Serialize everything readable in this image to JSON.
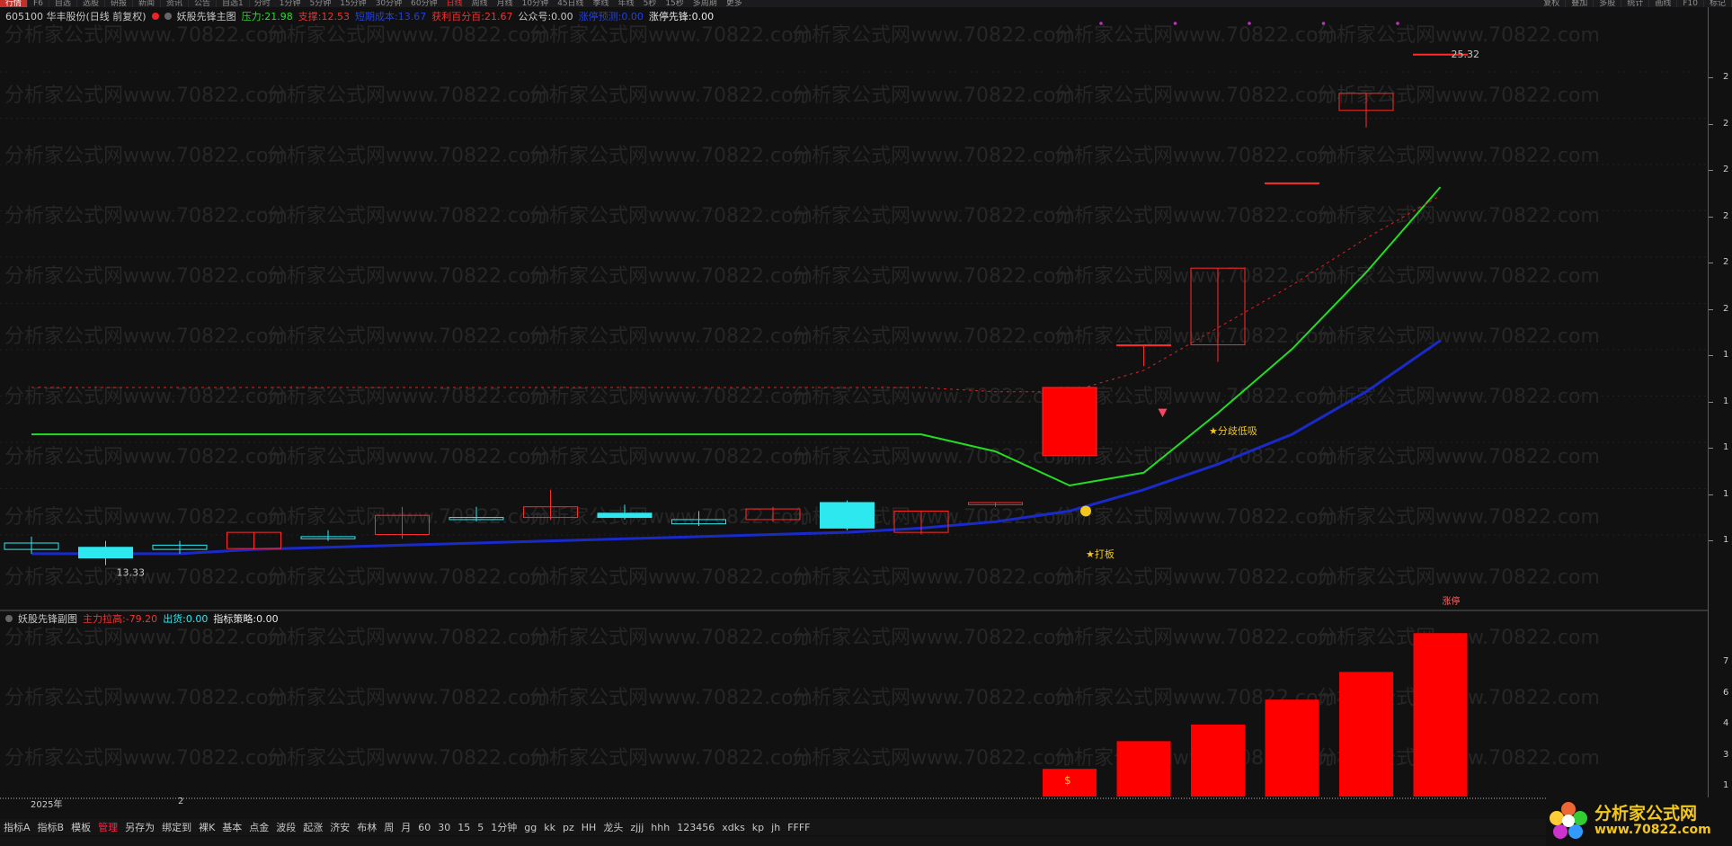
{
  "toolbar": {
    "items": [
      "行情",
      "F6",
      "自选",
      "选股",
      "研报",
      "新闻",
      "资讯",
      "公告",
      "自选1"
    ],
    "timeframes": [
      "分时",
      "1分钟",
      "5分钟",
      "15分钟",
      "30分钟",
      "60分钟",
      "日线",
      "周线",
      "月线",
      "10分钟",
      "45日线",
      "季线",
      "年线",
      "5秒",
      "15秒",
      "多周期",
      "更多"
    ],
    "active_timeframe": "日线",
    "right": [
      "复权",
      "叠加",
      "多股",
      "统计",
      "画线",
      "F10",
      "标记"
    ]
  },
  "main_info": {
    "stock": "605100 华丰股份(日线 前复权)",
    "indicator": "妖股先锋主图",
    "pressure_label": "压力:",
    "pressure_value": "21.98",
    "support_label": "支撑:",
    "support_value": "12.53",
    "field3_label": "短期成本:",
    "field3_value": "13.67",
    "profit_label": "获利百分百:",
    "profit_value": "21.67",
    "gonggong_label": "公众号:",
    "gonggong_value": "0.00",
    "field6_label": "涨停预测:",
    "field6_value": "0.00",
    "zt_label": "涨停先锋:",
    "zt_value": "0.00"
  },
  "sub_info": {
    "indicator": "妖股先锋副图",
    "main_label": "主力拉高:",
    "main_value": "-79.20",
    "chuhuo_label": "出货:",
    "chuhuo_value": "0.00",
    "strategy_label": "指标策略:",
    "strategy_value": "0.00"
  },
  "annotations": {
    "high": "25.32",
    "low": "13.33",
    "dab": "★打板",
    "fenqi": "★分歧低吸",
    "zhangting": "涨停"
  },
  "axis": {
    "main_ticks": [
      "2",
      "2",
      "2",
      "2",
      "2",
      "2",
      "1",
      "1",
      "1",
      "1",
      "1"
    ],
    "sub_ticks": [
      "7",
      "6",
      "4",
      "3",
      "1"
    ]
  },
  "xaxis": {
    "year": "2025年",
    "month": "2"
  },
  "watermark": "分析家公式网www.70822.com",
  "bottom_tabs": [
    "指标A",
    "指标B",
    "模板",
    "管理",
    "另存为",
    "绑定到",
    "裸K",
    "基本",
    "点金",
    "波段",
    "起涨",
    "济安",
    "布林",
    "周",
    "月",
    "60",
    "30",
    "15",
    "5",
    "1分钟",
    "gg",
    "kk",
    "pz",
    "HH",
    "龙头",
    "zjjj",
    "hhh",
    "123456",
    "xdks",
    "kp",
    "jh",
    "FFFF"
  ],
  "active_bottom_tab": "管理",
  "logo": {
    "title": "分析家公式网",
    "url": "www.70822.com"
  },
  "colors": {
    "up": "#ff2a2a",
    "down": "#2ee8f0",
    "green_line": "#22dd22",
    "blue_line": "#1a2ac8",
    "bar": "#ff0000",
    "text_yellow": "#f3c81b"
  },
  "chart_data": {
    "type": "candlestick",
    "title": "605100 华丰股份(日线 前复权)",
    "ylim": [
      12.5,
      26.0
    ],
    "candles": [
      {
        "o": 13.7,
        "c": 13.85,
        "h": 14.0,
        "l": 13.6,
        "dir": "down"
      },
      {
        "o": 13.75,
        "c": 13.5,
        "h": 13.9,
        "l": 13.33,
        "dir": "down"
      },
      {
        "o": 13.8,
        "c": 13.7,
        "h": 13.9,
        "l": 13.6,
        "dir": "down"
      },
      {
        "o": 13.72,
        "c": 14.1,
        "h": 14.1,
        "l": 13.7,
        "dir": "up"
      },
      {
        "o": 14.0,
        "c": 13.95,
        "h": 14.15,
        "l": 13.9,
        "dir": "down"
      },
      {
        "o": 14.05,
        "c": 14.5,
        "h": 14.7,
        "l": 13.95,
        "dir": "up"
      },
      {
        "o": 14.45,
        "c": 14.4,
        "h": 14.7,
        "l": 14.35,
        "dir": "down"
      },
      {
        "o": 14.45,
        "c": 14.7,
        "h": 15.1,
        "l": 14.4,
        "dir": "up"
      },
      {
        "o": 14.55,
        "c": 14.45,
        "h": 14.75,
        "l": 14.4,
        "dir": "down"
      },
      {
        "o": 14.4,
        "c": 14.3,
        "h": 14.6,
        "l": 14.25,
        "dir": "down"
      },
      {
        "o": 14.4,
        "c": 14.65,
        "h": 14.7,
        "l": 14.35,
        "dir": "up"
      },
      {
        "o": 14.8,
        "c": 14.2,
        "h": 14.85,
        "l": 14.15,
        "dir": "down"
      },
      {
        "o": 14.1,
        "c": 14.6,
        "h": 14.6,
        "l": 14.05,
        "dir": "up"
      },
      {
        "o": 14.75,
        "c": 14.8,
        "h": 14.8,
        "l": 14.7,
        "dir": "up"
      },
      {
        "o": 15.9,
        "c": 17.5,
        "h": 17.5,
        "l": 15.9,
        "dir": "up"
      },
      {
        "o": 18.5,
        "c": 18.5,
        "h": 18.5,
        "l": 18.0,
        "dir": "up"
      },
      {
        "o": 18.5,
        "c": 20.3,
        "h": 20.3,
        "l": 18.1,
        "dir": "up"
      },
      {
        "o": 22.3,
        "c": 22.3,
        "h": 22.3,
        "l": 22.3,
        "dir": "up"
      },
      {
        "o": 24.0,
        "c": 24.4,
        "h": 24.4,
        "l": 23.6,
        "dir": "up"
      },
      {
        "o": 25.32,
        "c": 25.32,
        "h": 25.32,
        "l": 25.32,
        "dir": "up"
      }
    ],
    "series": [
      {
        "name": "压力",
        "values": [
          16.4,
          16.4,
          16.4,
          16.4,
          16.4,
          16.4,
          16.4,
          16.4,
          16.4,
          16.4,
          16.4,
          16.4,
          16.4,
          16.0,
          15.2,
          15.5,
          16.9,
          18.4,
          20.2,
          22.2
        ]
      },
      {
        "name": "支撑",
        "values": [
          13.6,
          13.6,
          13.6,
          13.7,
          13.75,
          13.8,
          13.85,
          13.9,
          13.95,
          14.0,
          14.05,
          14.1,
          14.2,
          14.35,
          14.6,
          15.1,
          15.7,
          16.4,
          17.4,
          18.6
        ]
      },
      {
        "name": "获利百分百",
        "values": [
          17.5,
          17.5,
          17.5,
          17.5,
          17.5,
          17.5,
          17.5,
          17.5,
          17.5,
          17.5,
          17.5,
          17.5,
          17.5,
          17.4,
          17.4,
          17.9,
          18.9,
          19.9,
          21.0,
          22.0
        ]
      }
    ],
    "sub_type": "bar",
    "sub_values": [
      0,
      0,
      0,
      0,
      0,
      0,
      0,
      0,
      0,
      0,
      0,
      0,
      0,
      0,
      1,
      2,
      2.6,
      3.5,
      4.5,
      5.9
    ],
    "sub_ylim": [
      0,
      6.2
    ]
  }
}
